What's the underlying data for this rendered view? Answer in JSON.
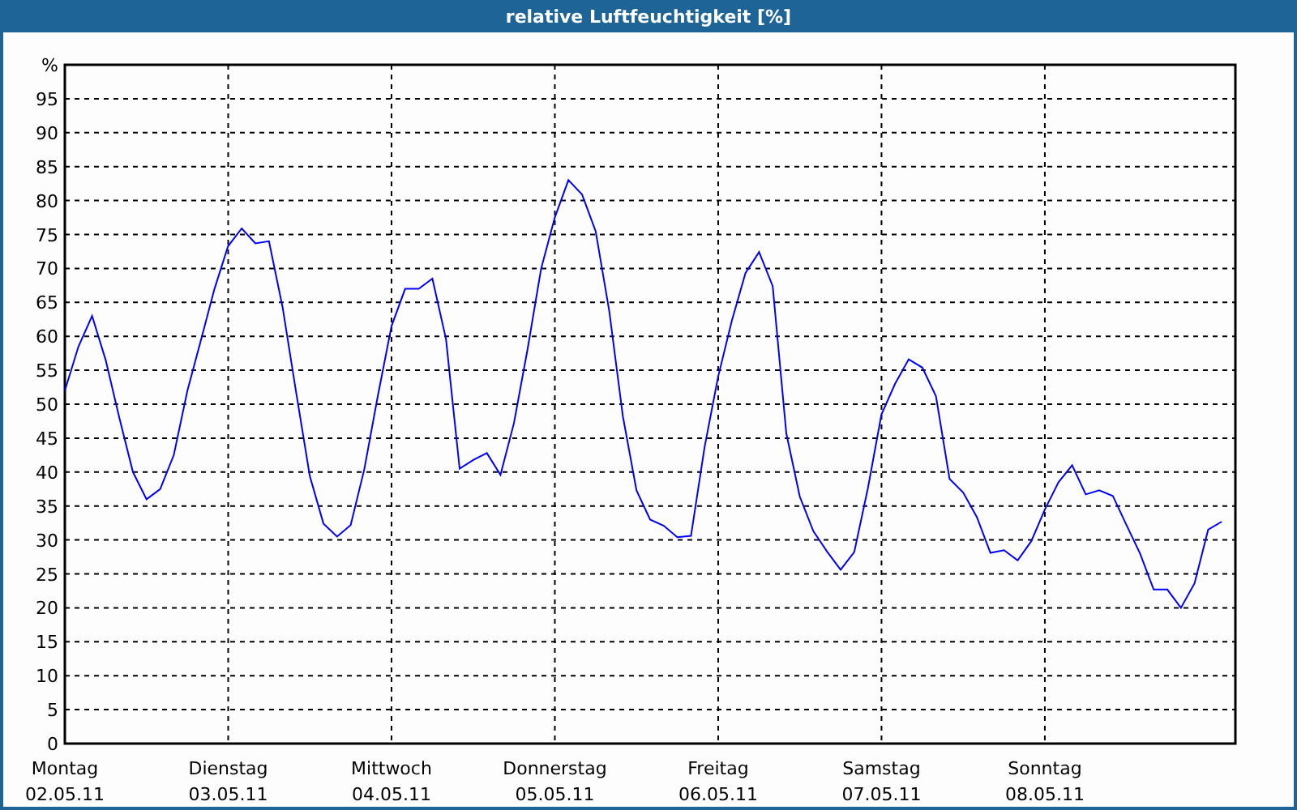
{
  "window": {
    "title": "relative Luftfeuchtigkeit [%]"
  },
  "chart": {
    "date_labels": [
      "02.05.11",
      "03.05.11",
      "04.05.11",
      "05.05.11",
      "06.05.11",
      "07.05.11",
      "08.05.11"
    ],
    "chart_data": {
      "type": "line",
      "grid": true,
      "ylabel": "%",
      "ylim": [
        0,
        100
      ],
      "yticks": [
        0,
        5,
        10,
        15,
        20,
        25,
        30,
        35,
        40,
        45,
        50,
        55,
        60,
        65,
        70,
        75,
        80,
        85,
        90,
        95
      ],
      "categories": [
        "Montag",
        null,
        null,
        null,
        null,
        null,
        null,
        null,
        null,
        null,
        null,
        null,
        "Dienstag",
        null,
        null,
        null,
        null,
        null,
        null,
        null,
        null,
        null,
        null,
        null,
        "Mittwoch",
        null,
        null,
        null,
        null,
        null,
        null,
        null,
        null,
        null,
        null,
        null,
        "Donnerstag",
        null,
        null,
        null,
        null,
        null,
        null,
        null,
        null,
        null,
        null,
        null,
        "Freitag",
        null,
        null,
        null,
        null,
        null,
        null,
        null,
        null,
        null,
        null,
        null,
        "Samstag",
        null,
        null,
        null,
        null,
        null,
        null,
        null,
        null,
        null,
        null,
        null,
        "Sonntag",
        null,
        null,
        null,
        null,
        null,
        null,
        null,
        null,
        null,
        null,
        null,
        null,
        null
      ],
      "series": [
        {
          "color": "#0000ff",
          "values": [
            52,
            58.5,
            63,
            56.5,
            48,
            40,
            36,
            37.5,
            42.5,
            52,
            59.5,
            67,
            73.3,
            75.9,
            73.7,
            74,
            64.3,
            51.7,
            39.4,
            32.4,
            30.5,
            32.2,
            40.4,
            51.3,
            61.5,
            67,
            67,
            68.5,
            59.6,
            40.5,
            41.8,
            42.8,
            39.6,
            47.2,
            58.1,
            70,
            77.5,
            83,
            80.9,
            75.5,
            63.7,
            48.2,
            37.3,
            33,
            32.1,
            30.4,
            30.6,
            43.7,
            54.1,
            62.3,
            69.3,
            72.4,
            67.4,
            45.7,
            36.4,
            31.3,
            28.3,
            25.6,
            28.2,
            37.6,
            48.5,
            53,
            56.6,
            55.4,
            51.2,
            39,
            37,
            33.4,
            28.1,
            28.5,
            27,
            29.8,
            34.5,
            38.5,
            41,
            36.7,
            37.3,
            36.5,
            32.2,
            28,
            22.7,
            22.7,
            20,
            23.6,
            31.5,
            32.7
          ]
        }
      ]
    }
  }
}
